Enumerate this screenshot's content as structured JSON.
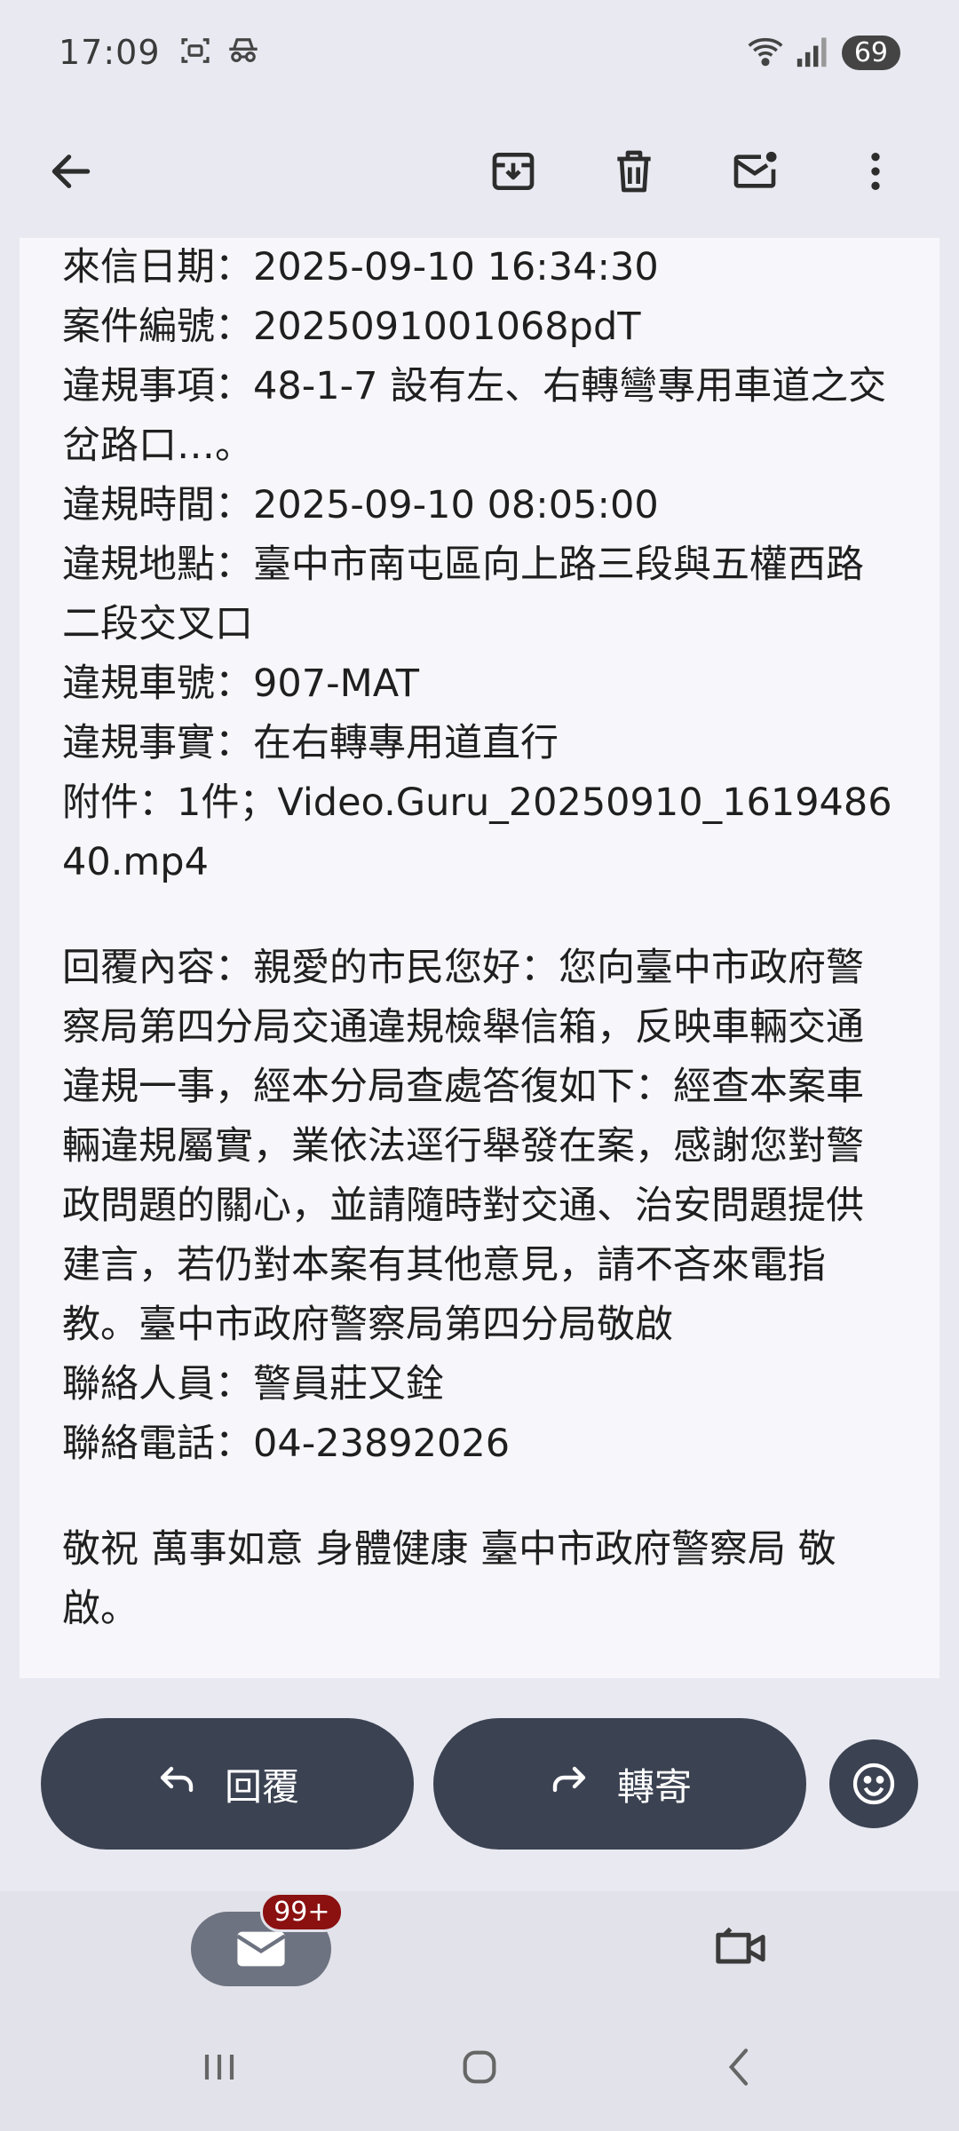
{
  "status_bar": {
    "time": "17:09",
    "battery": "69",
    "icons": [
      "screenshot-icon",
      "incognito-icon",
      "wifi-icon",
      "signal-icon"
    ]
  },
  "toolbar": {
    "icons": [
      "back-arrow-icon",
      "archive-icon",
      "delete-icon",
      "mark-unread-icon",
      "more-icon"
    ]
  },
  "message": {
    "lines": [
      "來信日期：2025-09-10 16:34:30",
      "案件編號：2025091001068pdT",
      "違規事項：48-1-7 設有左、右轉彎專用車道之交岔路口…。",
      "違規時間：2025-09-10 08:05:00",
      "違規地點：臺中市南屯區向上路三段與五權西路二段交叉口",
      "違規車號：907-MAT",
      "違規事實：在右轉專用道直行",
      "附件：1件；Video.Guru_20250910_161948640.mp4"
    ],
    "reply": "回覆內容：親愛的市民您好：您向臺中市政府警察局第四分局交通違規檢舉信箱，反映車輛交通違規一事，經本分局查處答復如下：經查本案車輛違規屬實，業依法逕行舉發在案，感謝您對警政問題的關心，並請隨時對交通、治安問題提供建言，若仍對本案有其他意見，請不吝來電指教。臺中市政府警察局第四分局敬啟",
    "contact_person": "聯絡人員：警員莊又銓",
    "contact_phone": "聯絡電話：04-23892026",
    "closing": "敬祝 萬事如意 身體健康 臺中市政府警察局 敬啟。"
  },
  "actions": {
    "reply_label": "回覆",
    "forward_label": "轉寄"
  },
  "bottom_nav": {
    "mail_badge": "99+"
  },
  "colors": {
    "background": "#e9e9f1",
    "card": "#f7f7fb",
    "pill": "#3b4252",
    "badge": "#8b1010"
  }
}
